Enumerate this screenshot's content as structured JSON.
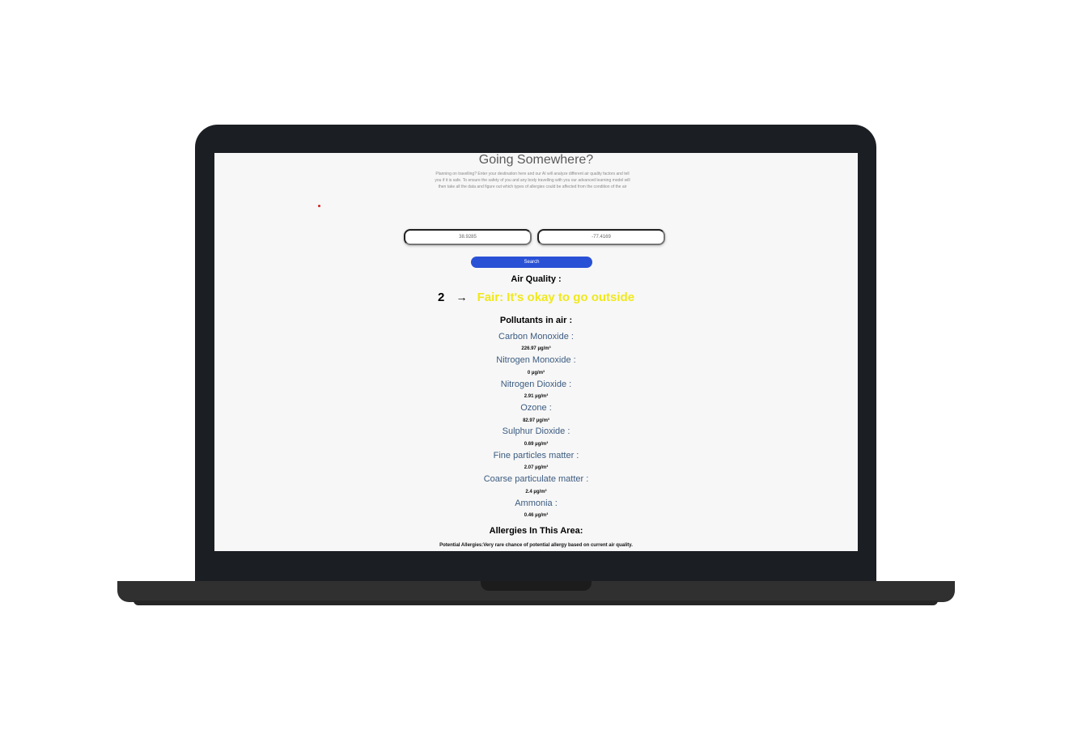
{
  "page": {
    "title": "Going Somewhere?",
    "intro": "Planning on travelling? Enter your destination here and our AI will analyze different air quality factors and tell you if it is safe. To ensure the safety of you and any body travelling with you our advanced learning model will then take all the data and figure out which types of allergies could be affected from the condition of the air"
  },
  "search": {
    "latitude": "38.9285",
    "longitude": "-77.4169",
    "button_label": "Search"
  },
  "air_quality": {
    "heading": "Air Quality :",
    "index": "2",
    "arrow": "→",
    "description": "Fair: It's okay to go outside",
    "description_color": "#f0e81c"
  },
  "pollutants": {
    "heading": "Pollutants in air :",
    "items": [
      {
        "name": "Carbon Monoxide :",
        "value": "226.97 µg/m³"
      },
      {
        "name": "Nitrogen Monoxide :",
        "value": "0 µg/m³"
      },
      {
        "name": "Nitrogen Dioxide :",
        "value": "2.91 µg/m³"
      },
      {
        "name": "Ozone :",
        "value": "82.97 µg/m³"
      },
      {
        "name": "Sulphur Dioxide :",
        "value": "0.69 µg/m³"
      },
      {
        "name": "Fine particles matter :",
        "value": "2.07 µg/m³"
      },
      {
        "name": "Coarse particulate matter :",
        "value": "2.4 µg/m³"
      },
      {
        "name": "Ammonia :",
        "value": "0.46 µg/m³"
      }
    ]
  },
  "allergies": {
    "heading": "Allergies In This Area:",
    "text": "Potential Allergies:Very rare chance of potential allergy based on current air quality."
  }
}
